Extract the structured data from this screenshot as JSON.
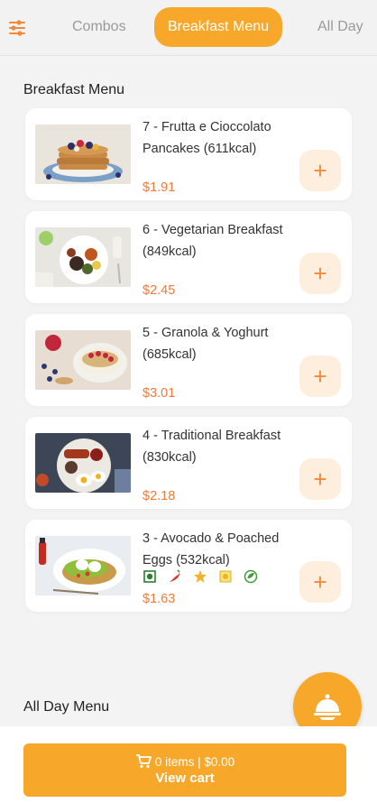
{
  "tabs": [
    {
      "label": "Combos",
      "active": false
    },
    {
      "label": "Breakfast Menu",
      "active": true
    },
    {
      "label": "All Day",
      "active": false
    }
  ],
  "sections": {
    "breakfast_title": "Breakfast Menu",
    "allday_title": "All Day Menu"
  },
  "items": [
    {
      "name": "7 - Frutta e Cioccolato Pancakes (611kcal)",
      "price": "$1.91",
      "image": "pancakes-image"
    },
    {
      "name": "6 - Vegetarian Breakfast (849kcal)",
      "price": "$2.45",
      "image": "vegetarian-breakfast-image"
    },
    {
      "name": "5 - Granola & Yoghurt (685kcal)",
      "price": "$3.01",
      "image": "granola-yoghurt-image"
    },
    {
      "name": "4 - Traditional Breakfast (830kcal)",
      "price": "$2.18",
      "image": "traditional-breakfast-image"
    },
    {
      "name": "3 - Avocado & Poached Eggs (532kcal)",
      "price": "$1.63",
      "image": "avocado-eggs-image"
    }
  ],
  "add_symbol": "+",
  "diet_icons": [
    "vegetarian-icon",
    "chili-icon",
    "star-icon",
    "sun-icon",
    "vegan-icon"
  ],
  "cart": {
    "summary": "0 items | $0.00",
    "label": "View cart"
  },
  "colors": {
    "accent": "#f7a82b",
    "price": "#f07a3a",
    "add_bg": "#fdeedd",
    "inactive_tab": "#9a9a9a"
  }
}
